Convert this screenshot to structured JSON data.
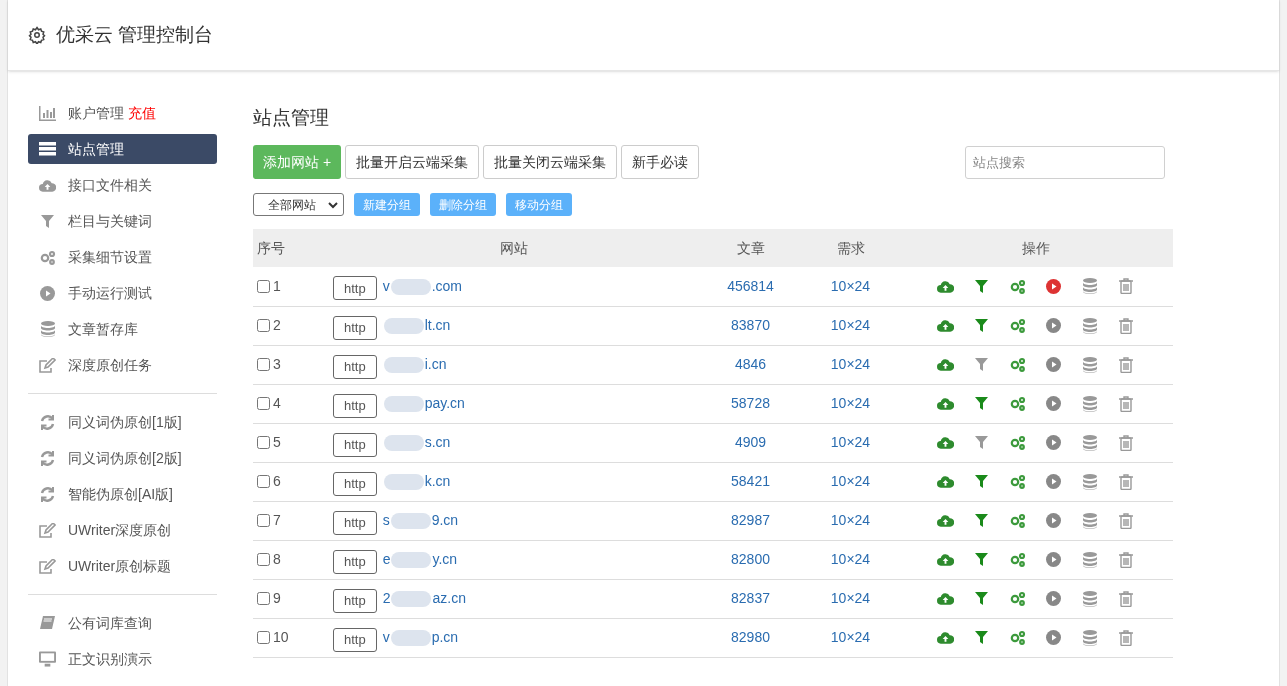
{
  "header": {
    "title": "优采云 管理控制台"
  },
  "sidebar": {
    "groups": [
      [
        {
          "kind": "chart",
          "label": "账户管理",
          "badge": "充值",
          "selected": false
        },
        {
          "kind": "server",
          "label": "站点管理",
          "selected": true
        },
        {
          "kind": "cloud",
          "label": "接口文件相关",
          "selected": false
        },
        {
          "kind": "filter",
          "label": "栏目与关键词",
          "selected": false
        },
        {
          "kind": "gears",
          "label": "采集细节设置",
          "selected": false
        },
        {
          "kind": "play",
          "label": "手动运行测试",
          "selected": false
        },
        {
          "kind": "database",
          "label": "文章暂存库",
          "selected": false
        },
        {
          "kind": "edit",
          "label": "深度原创任务",
          "selected": false
        }
      ],
      [
        {
          "kind": "refresh",
          "label": "同义词伪原创[1版]",
          "selected": false
        },
        {
          "kind": "refresh",
          "label": "同义词伪原创[2版]",
          "selected": false
        },
        {
          "kind": "refresh",
          "label": "智能伪原创[AI版]",
          "selected": false
        },
        {
          "kind": "edit",
          "label": "UWriter深度原创",
          "selected": false
        },
        {
          "kind": "edit",
          "label": "UWriter原创标题",
          "selected": false
        }
      ],
      [
        {
          "kind": "book",
          "label": "公有词库查询",
          "selected": false
        },
        {
          "kind": "monitor",
          "label": "正文识别演示",
          "selected": false
        }
      ]
    ]
  },
  "main": {
    "title": "站点管理",
    "buttons": [
      {
        "label": "添加网站 +",
        "kind": "primary"
      },
      {
        "label": "批量开启云端采集",
        "kind": "default"
      },
      {
        "label": "批量关闭云端采集",
        "kind": "default"
      },
      {
        "label": "新手必读",
        "kind": "default"
      }
    ],
    "search": {
      "placeholder": "站点搜索"
    },
    "group_select": {
      "value": "全部网站"
    },
    "group_buttons": [
      "新建分组",
      "删除分组",
      "移动分组"
    ],
    "table": {
      "columns": [
        "序号",
        "网站",
        "文章",
        "需求",
        "操作"
      ],
      "rows": [
        {
          "checked": false,
          "index": "1",
          "protocol": "http",
          "domain_start": "v",
          "domain_end": ".com",
          "articles": "456814",
          "demand": "10×24",
          "filter_on": true,
          "running": true
        },
        {
          "checked": false,
          "index": "2",
          "protocol": "http",
          "domain_end": "lt.cn",
          "articles": "83870",
          "demand": "10×24",
          "filter_on": true,
          "running": false
        },
        {
          "checked": false,
          "index": "3",
          "protocol": "http",
          "domain_end": "i.cn",
          "articles": "4846",
          "demand": "10×24",
          "filter_on": false,
          "running": false
        },
        {
          "checked": false,
          "index": "4",
          "protocol": "http",
          "domain_end": "pay.cn",
          "articles": "58728",
          "demand": "10×24",
          "filter_on": true,
          "running": false
        },
        {
          "checked": false,
          "index": "5",
          "protocol": "http",
          "domain_end": "s.cn",
          "articles": "4909",
          "demand": "10×24",
          "filter_on": false,
          "running": false
        },
        {
          "checked": false,
          "index": "6",
          "protocol": "http",
          "domain_end": "k.cn",
          "articles": "58421",
          "demand": "10×24",
          "filter_on": true,
          "running": false
        },
        {
          "checked": false,
          "index": "7",
          "protocol": "http",
          "domain_start": "s",
          "domain_end": "9.cn",
          "articles": "82987",
          "demand": "10×24",
          "filter_on": true,
          "running": false
        },
        {
          "checked": false,
          "index": "8",
          "protocol": "http",
          "domain_start": "e",
          "domain_end": "y.cn",
          "articles": "82800",
          "demand": "10×24",
          "filter_on": true,
          "running": false
        },
        {
          "checked": false,
          "index": "9",
          "protocol": "http",
          "domain_start": "2",
          "domain_end": "az.cn",
          "articles": "82837",
          "demand": "10×24",
          "filter_on": true,
          "running": false
        },
        {
          "checked": false,
          "index": "10",
          "protocol": "http",
          "domain_start": "v",
          "domain_end": "p.cn",
          "articles": "82980",
          "demand": "10×24",
          "filter_on": true,
          "running": false
        }
      ]
    }
  }
}
